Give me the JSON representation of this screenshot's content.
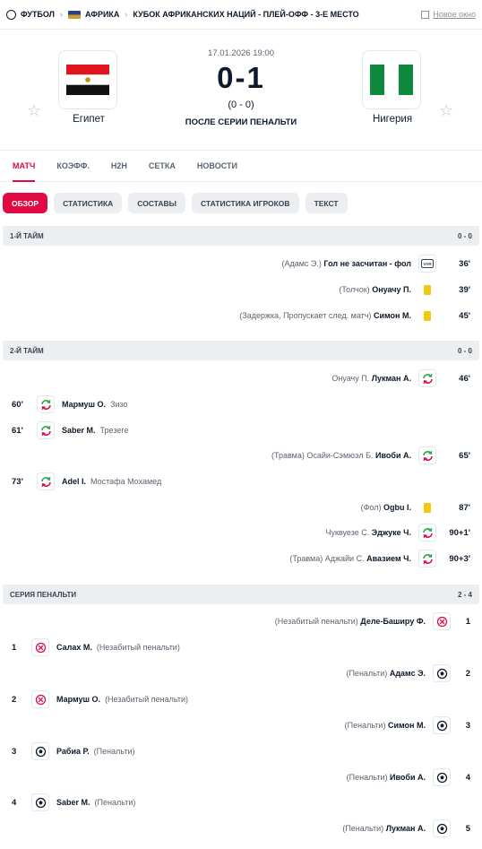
{
  "topbar": {
    "sport": "ФУТБОЛ",
    "region": "АФРИКА",
    "competition": "КУБОК АФРИКАНСКИХ НАЦИЙ - ПЛЕЙ-ОФФ - 3-Е МЕСТО",
    "new_window": "Новое окно"
  },
  "match": {
    "home": "Египет",
    "away": "Нигерия",
    "datetime": "17.01.2026 19:00",
    "score": "0-1",
    "halftime": "(0 - 0)",
    "status": "ПОСЛЕ СЕРИИ ПЕНАЛЬТИ"
  },
  "tabs": [
    "МАТЧ",
    "КОЭФФ.",
    "H2H",
    "СЕТКА",
    "НОВОСТИ"
  ],
  "subtabs": [
    "ОБЗОР",
    "СТАТИСТИКА",
    "СОСТАВЫ",
    "СТАТИСТИКА ИГРОКОВ",
    "ТЕКСТ"
  ],
  "sections": {
    "first_half": {
      "label": "1-Й ТАЙМ",
      "score": "0 - 0"
    },
    "second_half": {
      "label": "2-Й ТАЙМ",
      "score": "0 - 0"
    },
    "penalties": {
      "label": "СЕРИЯ ПЕНАЛЬТИ",
      "score": "2 - 4"
    }
  },
  "first_half_events": [
    {
      "pre": "(Адамс Э.)",
      "main": "Гол не засчитан - фол",
      "icon": "var-icon",
      "minute": "36'"
    },
    {
      "pre": "(Толчок)",
      "main": "Онуачу П.",
      "icon": "yellow-card-icon",
      "minute": "39'"
    },
    {
      "pre": "(Задержка, Пропускает след. матч)",
      "main": "Симон М.",
      "icon": "yellow-card-icon",
      "minute": "45'"
    }
  ],
  "second_half_events": [
    {
      "side": "r",
      "pre": "Онуачу П.",
      "main": "Лукман А.",
      "icon": "substitution-icon",
      "minute": "46'"
    },
    {
      "side": "l",
      "minute": "60'",
      "icon": "substitution-icon",
      "main": "Мармуш О.",
      "post": "Зизо"
    },
    {
      "side": "l",
      "minute": "61'",
      "icon": "substitution-icon",
      "main": "Saber M.",
      "post": "Трезеге"
    },
    {
      "side": "r",
      "pre": "(Травма) Осайи-Сэмюэл Б.",
      "main": "Ивоби А.",
      "icon": "substitution-icon",
      "minute": "65'"
    },
    {
      "side": "l",
      "minute": "73'",
      "icon": "substitution-icon",
      "main": "Adel I.",
      "post": "Мостафа Мохамед"
    },
    {
      "side": "r",
      "pre": "(Фол)",
      "main": "Ogbu I.",
      "icon": "yellow-card-icon",
      "minute": "87'"
    },
    {
      "side": "r",
      "pre": "Чуквуезе С.",
      "main": "Эджуке Ч.",
      "icon": "substitution-icon",
      "minute": "90+1'"
    },
    {
      "side": "r",
      "pre": "(Травма) Аджайи С.",
      "main": "Авазием Ч.",
      "icon": "substitution-icon",
      "minute": "90+3'"
    }
  ],
  "penalty_events": [
    {
      "side": "r",
      "pre": "(Незабитый пенальти)",
      "main": "Деле-Баширу Ф.",
      "icon": "penalty-missed-icon",
      "num": "1"
    },
    {
      "side": "l",
      "num": "1",
      "icon": "penalty-missed-icon",
      "main": "Салах М.",
      "post": "(Незабитый пенальти)"
    },
    {
      "side": "r",
      "pre": "(Пенальти)",
      "main": "Адамс Э.",
      "icon": "penalty-scored-icon",
      "num": "2"
    },
    {
      "side": "l",
      "num": "2",
      "icon": "penalty-missed-icon",
      "main": "Мармуш О.",
      "post": "(Незабитый пенальти)"
    },
    {
      "side": "r",
      "pre": "(Пенальти)",
      "main": "Симон М.",
      "icon": "penalty-scored-icon",
      "num": "3"
    },
    {
      "side": "l",
      "num": "3",
      "icon": "penalty-scored-icon",
      "main": "Рабиа Р.",
      "post": "(Пенальти)"
    },
    {
      "side": "r",
      "pre": "(Пенальти)",
      "main": "Ивоби А.",
      "icon": "penalty-scored-icon",
      "num": "4"
    },
    {
      "side": "l",
      "num": "4",
      "icon": "penalty-scored-icon",
      "main": "Saber M.",
      "post": "(Пенальти)"
    },
    {
      "side": "r",
      "pre": "(Пенальти)",
      "main": "Лукман А.",
      "icon": "penalty-scored-icon",
      "num": "5"
    }
  ],
  "colors": {
    "accent": "#e00b42",
    "yellow_card": "#f2c811",
    "sub_green": "#2fa84f",
    "sub_red": "#e00b42"
  }
}
